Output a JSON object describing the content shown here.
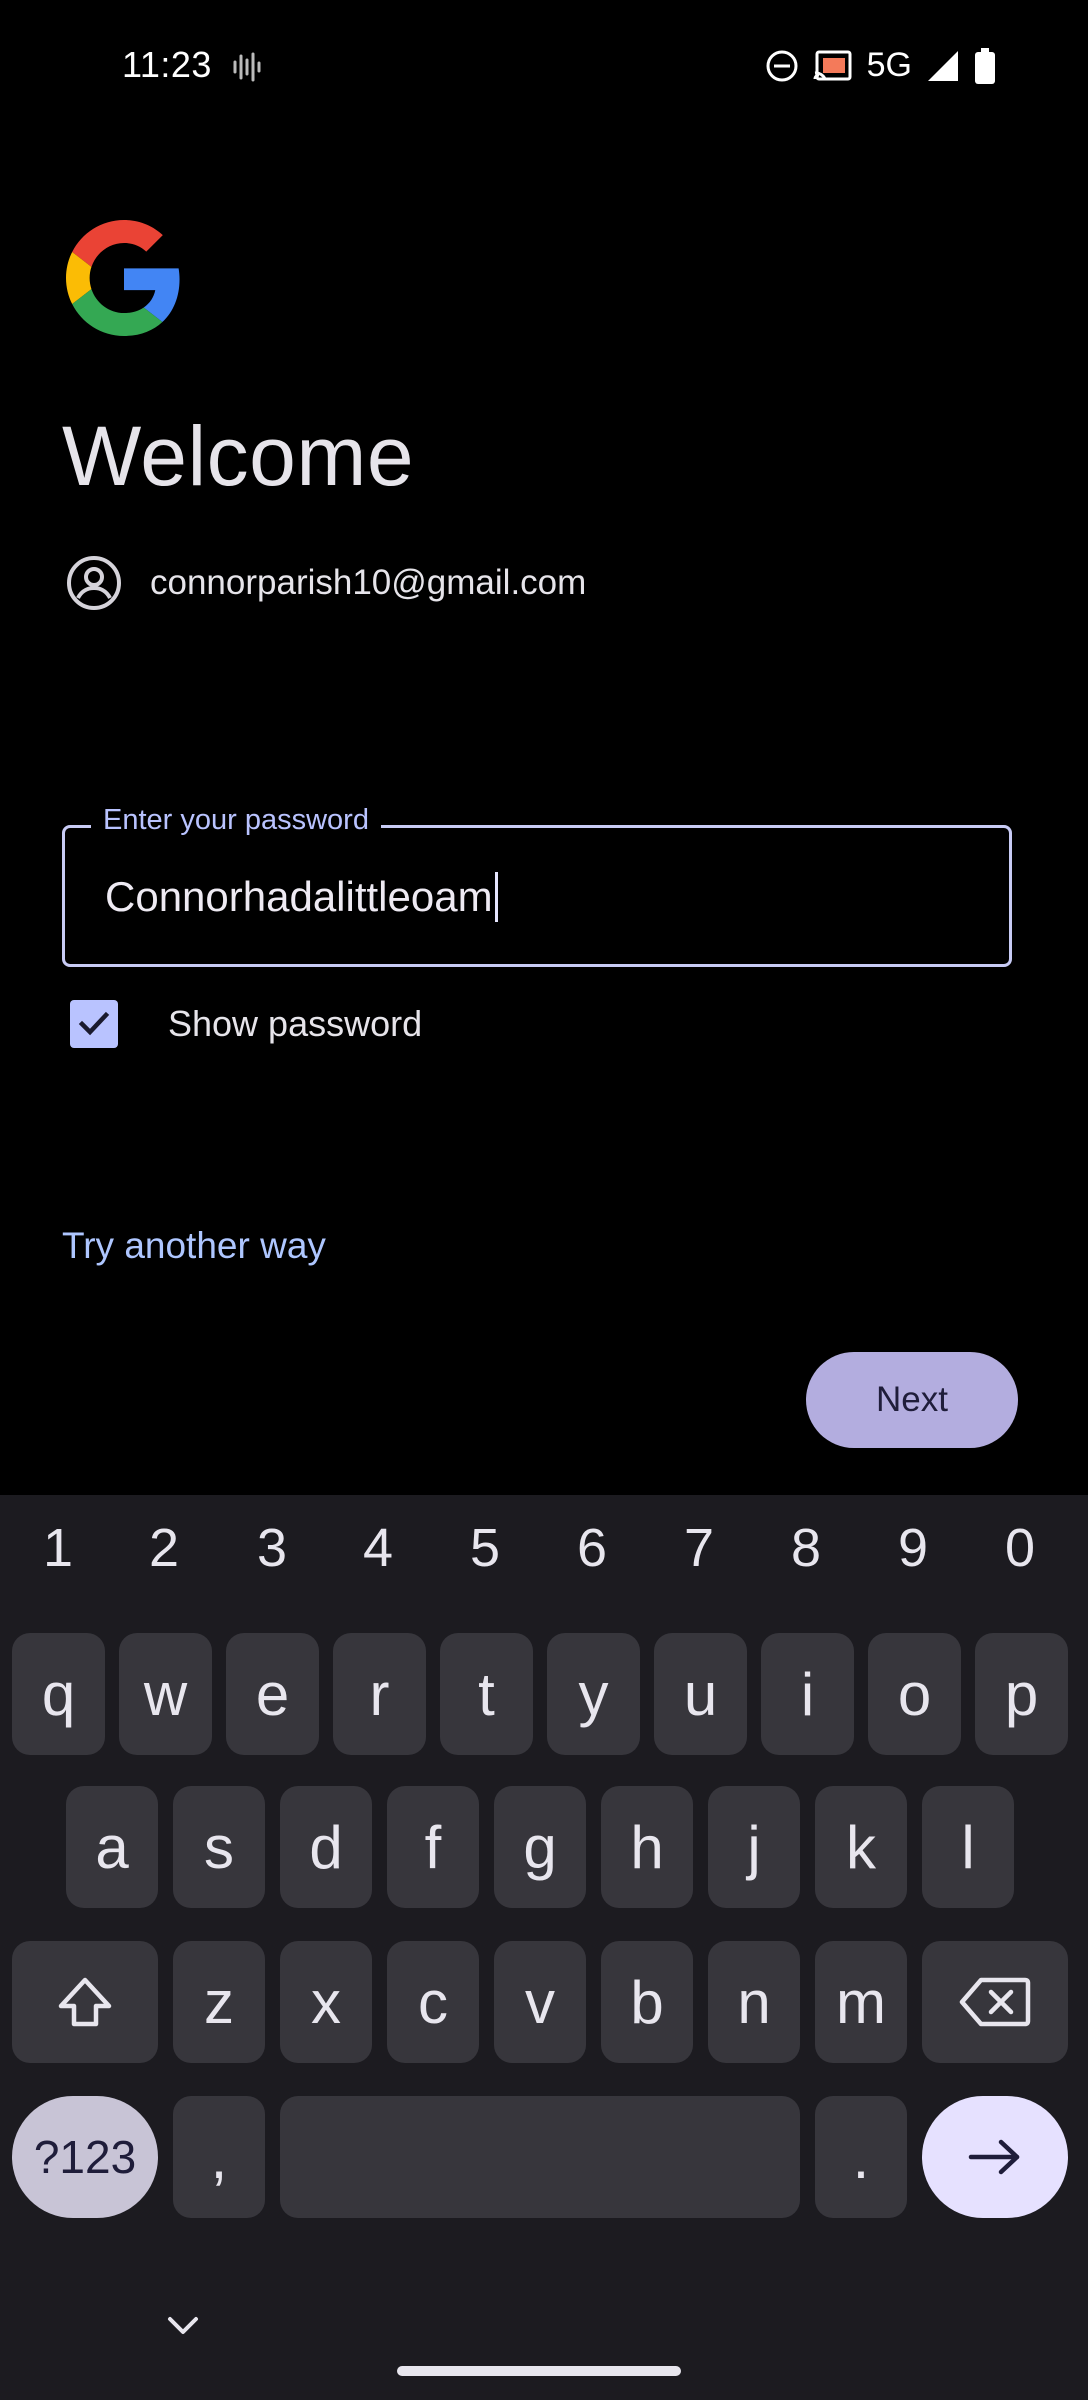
{
  "status_bar": {
    "time": "11:23",
    "network": "5G",
    "icons": [
      "sound-wave-icon",
      "do-not-disturb-icon",
      "cast-icon",
      "signal-icon",
      "battery-icon"
    ]
  },
  "logo": "google-g-logo",
  "heading": "Welcome",
  "account": {
    "email": "connorparish10@gmail.com",
    "icon": "account-circle-icon"
  },
  "password_field": {
    "label": "Enter your password",
    "value": "Connorhadalittleoam"
  },
  "show_password": {
    "label": "Show password",
    "checked": true
  },
  "try_another_way": "Try another way",
  "next_button": "Next",
  "colors": {
    "accent": "#b9c3ff",
    "next_bg": "#b3addf",
    "link": "#aec6ff",
    "keyboard_bg": "#1c1b20",
    "key_bg": "#37363c"
  },
  "keyboard": {
    "numbers": [
      "1",
      "2",
      "3",
      "4",
      "5",
      "6",
      "7",
      "8",
      "9",
      "0"
    ],
    "row1": [
      "q",
      "w",
      "e",
      "r",
      "t",
      "y",
      "u",
      "i",
      "o",
      "p"
    ],
    "row2": [
      "a",
      "s",
      "d",
      "f",
      "g",
      "h",
      "j",
      "k",
      "l"
    ],
    "row3": [
      "z",
      "x",
      "c",
      "v",
      "b",
      "n",
      "m"
    ],
    "symbols_key": "?123",
    "comma_key": ",",
    "period_key": "."
  }
}
